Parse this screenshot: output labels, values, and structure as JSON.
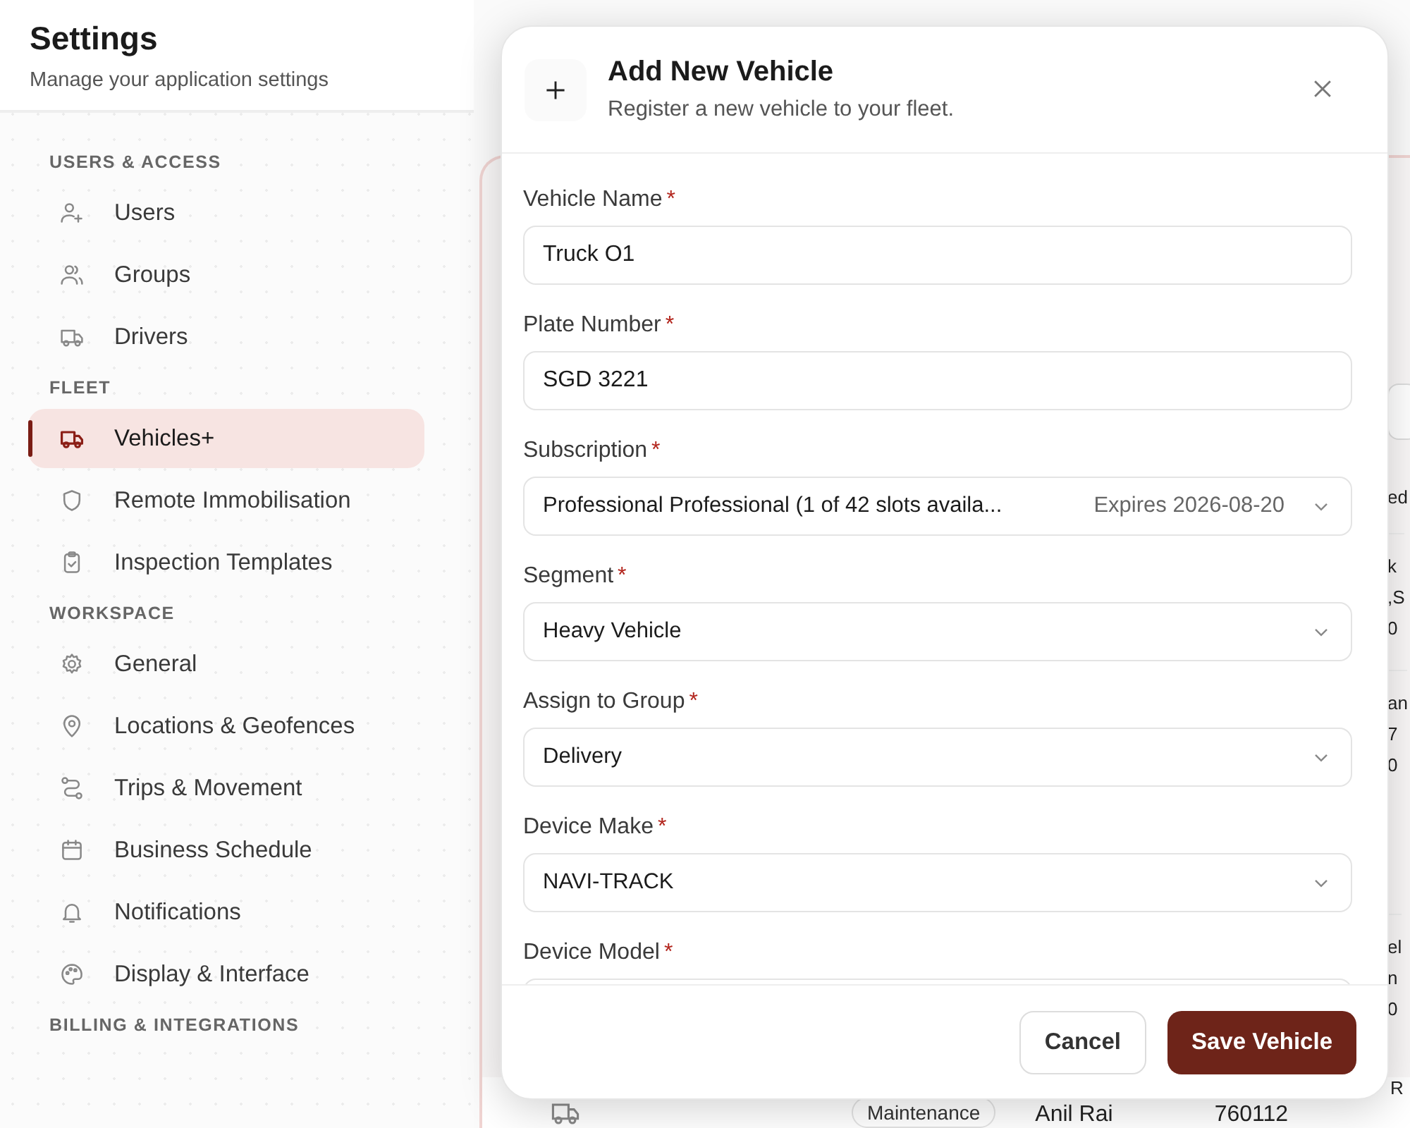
{
  "header": {
    "title": "Settings",
    "subtitle": "Manage your application settings"
  },
  "sidebar": {
    "sections": [
      {
        "title": "USERS & ACCESS",
        "items": [
          {
            "label": "Users",
            "selected": false
          },
          {
            "label": "Groups",
            "selected": false
          },
          {
            "label": "Drivers",
            "selected": false
          }
        ]
      },
      {
        "title": "FLEET",
        "items": [
          {
            "label": "Vehicles+",
            "selected": true
          },
          {
            "label": "Remote Immobilisation",
            "selected": false
          },
          {
            "label": "Inspection Templates",
            "selected": false
          }
        ]
      },
      {
        "title": "WORKSPACE",
        "items": [
          {
            "label": "General",
            "selected": false
          },
          {
            "label": "Locations & Geofences",
            "selected": false
          },
          {
            "label": "Trips & Movement",
            "selected": false
          },
          {
            "label": "Business Schedule",
            "selected": false
          },
          {
            "label": "Notifications",
            "selected": false
          },
          {
            "label": "Display & Interface",
            "selected": false
          }
        ]
      },
      {
        "title": "BILLING & INTEGRATIONS"
      }
    ]
  },
  "background_table": {
    "edge_texts": [
      [
        "ed"
      ],
      [
        "k",
        ",S",
        "0"
      ],
      [
        "an",
        "7",
        "0"
      ],
      [
        "el",
        "n",
        "0"
      ]
    ],
    "bottom_row": {
      "status": "Maintenance",
      "driver": "Anil Rai",
      "number": "760112",
      "edge": "R"
    }
  },
  "modal": {
    "title": "Add New Vehicle",
    "subtitle": "Register a new vehicle to your fleet.",
    "fields": [
      {
        "kind": "text",
        "label": "Vehicle Name",
        "required_mark": "*",
        "value": "Truck O1"
      },
      {
        "kind": "text",
        "label": "Plate Number",
        "required_mark": "*",
        "value": "SGD 3221"
      },
      {
        "kind": "select",
        "label": "Subscription",
        "required_mark": "*",
        "value": "Professional Professional (1 of 42 slots availa...",
        "note": "Expires 2026-08-20"
      },
      {
        "kind": "select",
        "label": "Segment",
        "required_mark": "*",
        "value": "Heavy Vehicle"
      },
      {
        "kind": "select",
        "label": "Assign to Group",
        "required_mark": "*",
        "value": "Delivery"
      },
      {
        "kind": "select",
        "label": "Device Make",
        "required_mark": "*",
        "value": "NAVI-TRACK"
      },
      {
        "kind": "select",
        "label": "Device Model",
        "required_mark": "*"
      }
    ],
    "buttons": [
      {
        "kind": "secondary",
        "label": "Cancel"
      },
      {
        "kind": "primary",
        "label": "Save Vehicle"
      }
    ]
  }
}
